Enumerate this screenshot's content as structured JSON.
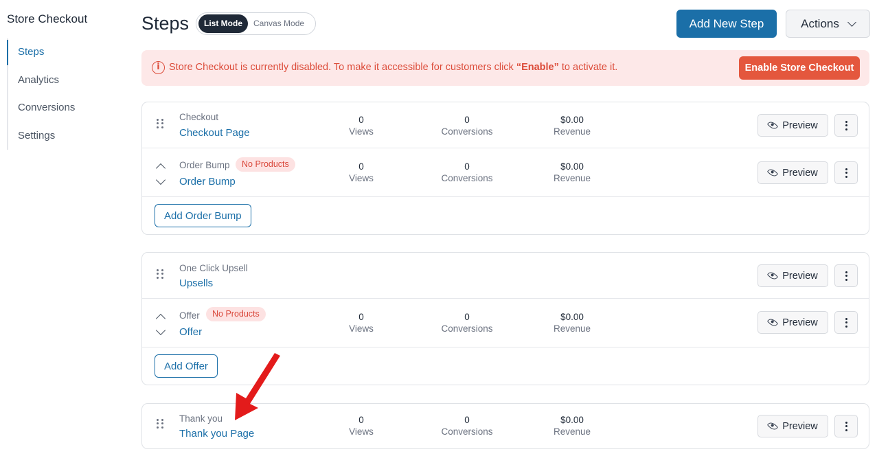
{
  "sidebar": {
    "title": "Store Checkout",
    "items": [
      {
        "label": "Steps",
        "active": true
      },
      {
        "label": "Analytics",
        "active": false
      },
      {
        "label": "Conversions",
        "active": false
      },
      {
        "label": "Settings",
        "active": false
      }
    ]
  },
  "header": {
    "title": "Steps",
    "modes": [
      "List Mode",
      "Canvas Mode"
    ],
    "active_mode": "List Mode",
    "add_button": "Add New Step",
    "actions_button": "Actions"
  },
  "alert": {
    "text_before": "Store Checkout is currently disabled. To make it accessible for customers click ",
    "highlight": "“Enable”",
    "text_after": " to activate it.",
    "button": "Enable Store Checkout",
    "icon": "info-icon",
    "color": "#dc4c3a"
  },
  "metric_labels": {
    "views": "Views",
    "conversions": "Conversions",
    "revenue": "Revenue"
  },
  "preview_label": "Preview",
  "groups": [
    {
      "main": {
        "type": "Checkout",
        "name": "Checkout Page",
        "views": "0",
        "conversions": "0",
        "revenue": "$0.00"
      },
      "sub": {
        "type": "Order Bump",
        "badge": "No Products",
        "name": "Order Bump",
        "views": "0",
        "conversions": "0",
        "revenue": "$0.00"
      },
      "add_button": "Add Order Bump"
    },
    {
      "main": {
        "type": "One Click Upsell",
        "name": "Upsells"
      },
      "sub": {
        "type": "Offer",
        "badge": "No Products",
        "name": "Offer",
        "views": "0",
        "conversions": "0",
        "revenue": "$0.00"
      },
      "add_button": "Add Offer"
    },
    {
      "main": {
        "type": "Thank you",
        "name": "Thank you Page",
        "views": "0",
        "conversions": "0",
        "revenue": "$0.00"
      }
    }
  ],
  "colors": {
    "accent": "#1b6fa8",
    "danger": "#e4573d",
    "annotation": "#e31b1b"
  }
}
